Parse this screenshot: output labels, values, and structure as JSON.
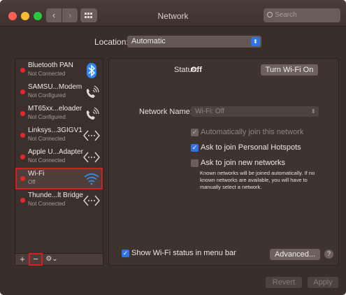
{
  "window": {
    "title": "Network"
  },
  "toolbar": {
    "search_placeholder": "Search"
  },
  "location": {
    "label": "Location:",
    "value": "Automatic"
  },
  "services": [
    {
      "name": "Bluetooth PAN",
      "status": "Not Connected",
      "icon": "bluetooth-icon"
    },
    {
      "name": "SAMSU...Modem",
      "status": "Not Configured",
      "icon": "phone-icon"
    },
    {
      "name": "MT65xx...eloader",
      "status": "Not Configured",
      "icon": "phone-icon"
    },
    {
      "name": "Linksys...3GIGV1",
      "status": "Not Connected",
      "icon": "ethernet-icon"
    },
    {
      "name": "Apple U...Adapter",
      "status": "Not Connected",
      "icon": "ethernet-icon"
    },
    {
      "name": "Wi-Fi",
      "status": "Off",
      "icon": "wifi-icon"
    },
    {
      "name": "Thunde...lt Bridge",
      "status": "Not Connected",
      "icon": "ethernet-icon"
    }
  ],
  "sidebar_tools": {
    "add": "+",
    "remove": "−",
    "gear": "⚙⌄"
  },
  "detail": {
    "status_label": "Status:",
    "status_value": "Off",
    "turn_wifi_button": "Turn Wi-Fi On",
    "network_name_label": "Network Name:",
    "network_name_value": "Wi-Fi: Off",
    "options": [
      {
        "label": "Automatically join this network",
        "checked": true,
        "enabled": false
      },
      {
        "label": "Ask to join Personal Hotspots",
        "checked": true,
        "enabled": true
      },
      {
        "label": "Ask to join new networks",
        "checked": false,
        "enabled": true
      }
    ],
    "options_help": "Known networks will be joined automatically. If no known networks are available, you will have to manually select a network.",
    "show_status_label": "Show Wi-Fi status in menu bar",
    "advanced_button": "Advanced...",
    "help_button": "?"
  },
  "footer": {
    "revert": "Revert",
    "apply": "Apply"
  },
  "colors": {
    "status_red": "#e8262b",
    "accent_blue": "#2f73e6",
    "selection_outline": "#d32020"
  }
}
